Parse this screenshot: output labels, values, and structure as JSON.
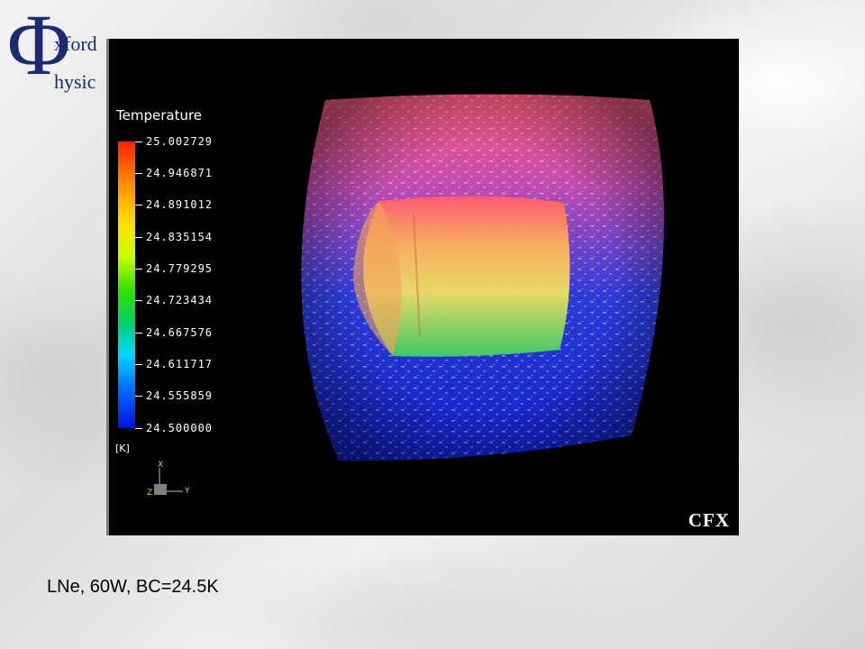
{
  "logo": {
    "symbol": "Φ",
    "line1": "xford",
    "line2": "hysic",
    "color": "#1b2a72"
  },
  "simulation": {
    "legend_title": "Temperature",
    "legend_values": [
      "25.002729",
      "24.946871",
      "24.891012",
      "24.835154",
      "24.779295",
      "24.723434",
      "24.667576",
      "24.611717",
      "24.555859",
      "24.500000"
    ],
    "unit": "[K]",
    "axes": {
      "x": "X",
      "y": "Y",
      "z": "Z"
    },
    "software_label": "CFX",
    "colors": {
      "hot": "#ff2000",
      "warm": "#ffdd00",
      "mid": "#30e000",
      "cold": "#0010e0",
      "background": "#000000"
    }
  },
  "caption": "LNe, 60W, BC=24.5K"
}
